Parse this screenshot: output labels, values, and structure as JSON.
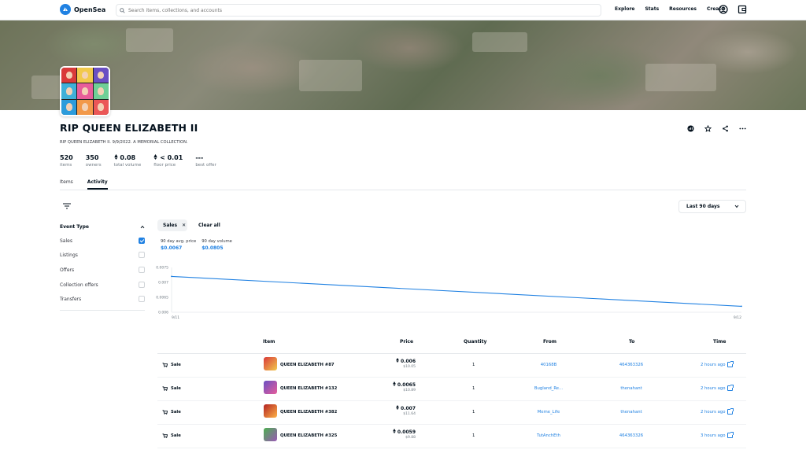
{
  "header": {
    "brand": "OpenSea",
    "search_placeholder": "Search items, collections, and accounts",
    "nav": [
      "Explore",
      "Stats",
      "Resources",
      "Create"
    ]
  },
  "collection": {
    "title": "RIP QUEEN ELIZABETH II",
    "description": "RIP QUEEN ELIZABETH II. 9/9/2022. A MEMORIAL COLLECTION.",
    "stats": [
      {
        "value": "520",
        "label": "items"
      },
      {
        "value": "350",
        "label": "owners"
      },
      {
        "value": "0.08",
        "label": "total volume",
        "eth": true
      },
      {
        "value": "< 0.01",
        "label": "floor price",
        "eth": true
      },
      {
        "value": "---",
        "label": "best offer"
      }
    ]
  },
  "tabs": [
    "Items",
    "Activity"
  ],
  "active_tab": "Activity",
  "date_filter": "Last 90 days",
  "sidebar": {
    "heading": "Event Type",
    "items": [
      {
        "label": "Sales",
        "checked": true
      },
      {
        "label": "Listings",
        "checked": false
      },
      {
        "label": "Offers",
        "checked": false
      },
      {
        "label": "Collection offers",
        "checked": false
      },
      {
        "label": "Transfers",
        "checked": false
      }
    ]
  },
  "chips": {
    "active": "Sales",
    "clear": "Clear all"
  },
  "metrics": [
    {
      "label": "90 day avg. price",
      "value": "$0.0067"
    },
    {
      "label": "90 day volume",
      "value": "$0.0805"
    }
  ],
  "chart_data": {
    "type": "line",
    "x": [
      "9/11",
      "9/12"
    ],
    "x_ticks": [
      "9/11",
      "9/12"
    ],
    "y_ticks": [
      "0.0075",
      "0.007",
      "0.0065",
      "0.006"
    ],
    "ylim": [
      0.006,
      0.0075
    ],
    "series": [
      {
        "values": [
          0.0072,
          0.0062
        ]
      }
    ],
    "grid": false
  },
  "table": {
    "headers": [
      "Item",
      "Price",
      "Quantity",
      "From",
      "To",
      "Time"
    ],
    "rows": [
      {
        "event": "Sale",
        "item": "QUEEN ELIZABETH #87",
        "price": "0.006",
        "usd": "$10.05",
        "qty": "1",
        "from": "40168B",
        "to": "464363326",
        "time": "2 hours ago"
      },
      {
        "event": "Sale",
        "item": "QUEEN ELIZABETH #132",
        "price": "0.0065",
        "usd": "$10.89",
        "qty": "1",
        "from": "Bugland_Re...",
        "to": "thenahant",
        "time": "2 hours ago"
      },
      {
        "event": "Sale",
        "item": "QUEEN ELIZABETH #382",
        "price": "0.007",
        "usd": "$11.64",
        "qty": "1",
        "from": "Meme_Life",
        "to": "thenahant",
        "time": "2 hours ago"
      },
      {
        "event": "Sale",
        "item": "QUEEN ELIZABETH #325",
        "price": "0.0059",
        "usd": "$9.88",
        "qty": "1",
        "from": "TutAnchEth",
        "to": "464363326",
        "time": "3 hours ago"
      }
    ]
  },
  "colors": {
    "accent": "#2081e2",
    "text": "#04111d"
  }
}
